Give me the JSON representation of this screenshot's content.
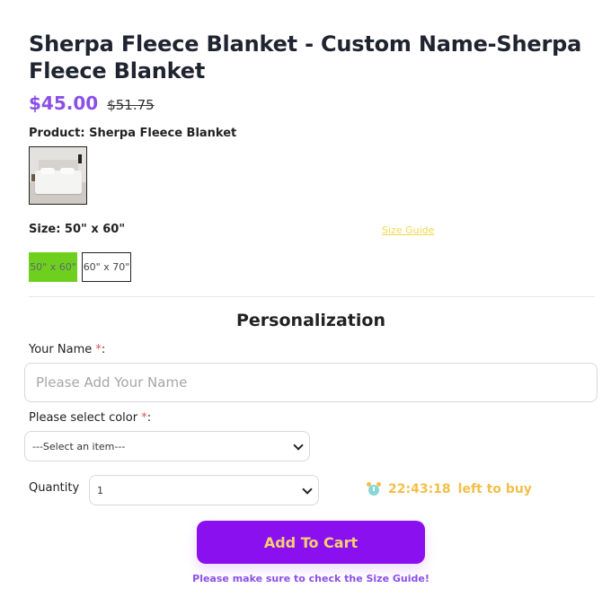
{
  "product": {
    "title": "Sherpa Fleece Blanket - Custom Name-Sherpa Fleece Blanket",
    "price": "$45.00",
    "old_price": "$51.75",
    "product_label": "Product: Sherpa Fleece Blanket"
  },
  "size": {
    "label": "Size: 50\" x 60\"",
    "guide_link": "Size Guide",
    "options": [
      {
        "label": "50\" x 60\"",
        "selected": true
      },
      {
        "label": "60\" x 70\"",
        "selected": false
      }
    ]
  },
  "personalization": {
    "title": "Personalization",
    "name_label": "Your Name",
    "name_required": "*",
    "name_placeholder": "Please Add Your Name",
    "color_label": "Please select color",
    "color_required": "*",
    "color_value": "---Select an item---",
    "quantity_label": "Quantity",
    "quantity_value": "1"
  },
  "timer": {
    "time": "22:43:18",
    "suffix": "left to buy",
    "icon": "alarm-clock-icon"
  },
  "cart": {
    "button_label": "Add To Cart",
    "note": "Please make sure to check the Size Guide!"
  },
  "colors": {
    "accent_purple": "#8a10f0",
    "price_purple": "#8b4fe6",
    "selected_green": "#6fcf1f",
    "timer_yellow": "#f2c04a"
  }
}
